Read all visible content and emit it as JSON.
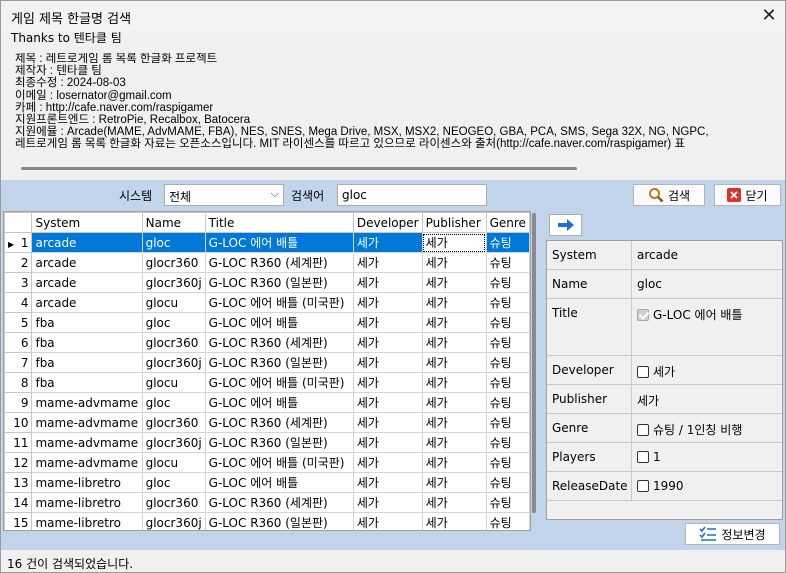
{
  "window": {
    "title": "게임 제목 한글명 검색",
    "close_glyph": "✕"
  },
  "thanks": "Thanks to 텐타클 팀",
  "info_lines": [
    "제목 : 레트로게임 롬 목록 한글화 프로젝트",
    "제작자 : 텐타클 팀",
    "최종수정 : 2024-08-03",
    "이메일 : losernator@gmail.com",
    "카페 : http://cafe.naver.com/raspigamer",
    "지원프론트엔드 : RetroPie, Recalbox, Batocera",
    "지원에뮬 : Arcade(MAME, AdvMAME, FBA), NES, SNES, Mega Drive, MSX, MSX2, NEOGEO, GBA, PCA, SMS, Sega 32X, NG, NGPC,",
    "레트로게임 롬 목록 한글화 자료는 오픈소스입니다. MIT 라이센스를 따르고 있으므로 라이센스와 출처(http://cafe.naver.com/raspigamer) 표"
  ],
  "filter": {
    "system_label": "시스템",
    "system_value": "전체",
    "keyword_label": "검색어",
    "keyword_value": "gloc"
  },
  "buttons": {
    "search": "검색",
    "close": "닫기",
    "update": "정보변경"
  },
  "grid": {
    "columns": [
      "System",
      "Name",
      "Title",
      "Developer",
      "Publisher",
      "Genre"
    ],
    "rows": [
      {
        "n": "1",
        "system": "arcade",
        "name": "gloc",
        "title": "G-LOC 에어 배틀",
        "dev": "세가",
        "pub": "세가",
        "genre": "슈팅"
      },
      {
        "n": "2",
        "system": "arcade",
        "name": "glocr360",
        "title": "G-LOC R360 (세계판)",
        "dev": "세가",
        "pub": "세가",
        "genre": "슈팅"
      },
      {
        "n": "3",
        "system": "arcade",
        "name": "glocr360j",
        "title": "G-LOC R360 (일본판)",
        "dev": "세가",
        "pub": "세가",
        "genre": "슈팅"
      },
      {
        "n": "4",
        "system": "arcade",
        "name": "glocu",
        "title": "G-LOC 에어 배틀 (미국판)",
        "dev": "세가",
        "pub": "세가",
        "genre": "슈팅"
      },
      {
        "n": "5",
        "system": "fba",
        "name": "gloc",
        "title": "G-LOC 에어 배틀",
        "dev": "세가",
        "pub": "세가",
        "genre": "슈팅"
      },
      {
        "n": "6",
        "system": "fba",
        "name": "glocr360",
        "title": "G-LOC R360 (세계판)",
        "dev": "세가",
        "pub": "세가",
        "genre": "슈팅"
      },
      {
        "n": "7",
        "system": "fba",
        "name": "glocr360j",
        "title": "G-LOC R360 (일본판)",
        "dev": "세가",
        "pub": "세가",
        "genre": "슈팅"
      },
      {
        "n": "8",
        "system": "fba",
        "name": "glocu",
        "title": "G-LOC 에어 배틀 (미국판)",
        "dev": "세가",
        "pub": "세가",
        "genre": "슈팅"
      },
      {
        "n": "9",
        "system": "mame-advmame",
        "name": "gloc",
        "title": "G-LOC 에어 배틀",
        "dev": "세가",
        "pub": "세가",
        "genre": "슈팅"
      },
      {
        "n": "10",
        "system": "mame-advmame",
        "name": "glocr360",
        "title": "G-LOC R360 (세계판)",
        "dev": "세가",
        "pub": "세가",
        "genre": "슈팅"
      },
      {
        "n": "11",
        "system": "mame-advmame",
        "name": "glocr360j",
        "title": "G-LOC R360 (일본판)",
        "dev": "세가",
        "pub": "세가",
        "genre": "슈팅"
      },
      {
        "n": "12",
        "system": "mame-advmame",
        "name": "glocu",
        "title": "G-LOC 에어 배틀 (미국판)",
        "dev": "세가",
        "pub": "세가",
        "genre": "슈팅"
      },
      {
        "n": "13",
        "system": "mame-libretro",
        "name": "gloc",
        "title": "G-LOC 에어 배틀",
        "dev": "세가",
        "pub": "세가",
        "genre": "슈팅"
      },
      {
        "n": "14",
        "system": "mame-libretro",
        "name": "glocr360",
        "title": "G-LOC R360 (세계판)",
        "dev": "세가",
        "pub": "세가",
        "genre": "슈팅"
      },
      {
        "n": "15",
        "system": "mame-libretro",
        "name": "glocr360j",
        "title": "G-LOC R360 (일본판)",
        "dev": "세가",
        "pub": "세가",
        "genre": "슈팅"
      }
    ]
  },
  "details": [
    {
      "key": "System",
      "value": "arcade",
      "checkbox": "none"
    },
    {
      "key": "Name",
      "value": "gloc",
      "checkbox": "none"
    },
    {
      "key": "Title",
      "value": "G-LOC 에어 배틀",
      "checkbox": "checked"
    },
    {
      "key": "Developer",
      "value": "세가",
      "checkbox": "unchecked"
    },
    {
      "key": "Publisher",
      "value": "세가",
      "checkbox": "none"
    },
    {
      "key": "Genre",
      "value": "슈팅 / 1인칭 비행",
      "checkbox": "unchecked"
    },
    {
      "key": "Players",
      "value": "1",
      "checkbox": "unchecked"
    },
    {
      "key": "ReleaseDate",
      "value": "1990",
      "checkbox": "unchecked"
    }
  ],
  "status": "16 건이 검색되었습니다.",
  "colors": {
    "band": "#c2d4ea",
    "selection": "#0078d7",
    "arrow": "#1e6fd9"
  },
  "icons": {
    "search": "magnifier-icon",
    "close": "red-x-icon",
    "arrow": "arrow-right-icon",
    "update": "checklist-icon"
  }
}
